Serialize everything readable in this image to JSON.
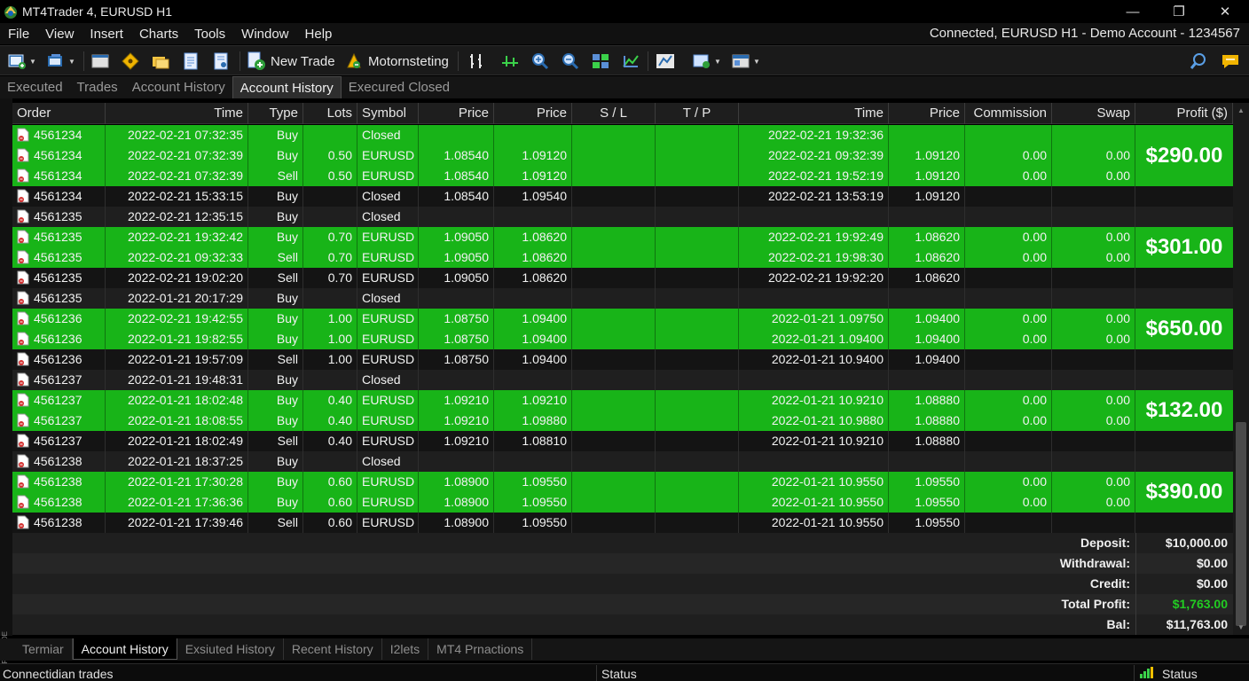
{
  "window": {
    "title": "MT4Trader 4, EURUSD  H1",
    "controls": {
      "minimize": "—",
      "restore": "❐",
      "close": "✕"
    }
  },
  "menu": {
    "items": [
      "File",
      "View",
      "Insert",
      "Charts",
      "Tools",
      "Window",
      "Help"
    ],
    "connection_status": "Connected, EURUSD H1 - Demo Account - 1234567"
  },
  "toolbar": {
    "new_trade_label": "New Trade",
    "motorsteting_label": "Motornsteting"
  },
  "top_tabs": {
    "items": [
      "Executed",
      "Trades",
      "Account History",
      "Account History",
      "Execured Closed"
    ],
    "active_index": 3
  },
  "table": {
    "headers": [
      "Order",
      "Time",
      "Type",
      "Lots",
      "Symbol",
      "Price",
      "Price",
      "S / L",
      "T / P",
      "Time",
      "Price",
      "Commission",
      "Swap",
      "Profit ($)"
    ],
    "rows": [
      {
        "style": "g",
        "order": "4561234",
        "time": "2022-02-21 07:32:35",
        "type": "Buy",
        "lots": "",
        "symbol": "Closed",
        "price1": "",
        "price2": "",
        "sl": "",
        "tp": "",
        "time2": "2022-02-21 19:32:36",
        "price3": "",
        "commission": "",
        "swap": ""
      },
      {
        "style": "g",
        "order": "4561234",
        "time": "2022-02-21 07:32:39",
        "type": "Buy",
        "lots": "0.50",
        "symbol": "EURUSD",
        "price1": "1.08540",
        "price2": "1.09120",
        "sl": "",
        "tp": "",
        "time2": "2022-02-21 09:32:39",
        "price3": "1.09120",
        "commission": "0.00",
        "swap": "0.00"
      },
      {
        "style": "g",
        "order": "4561234",
        "time": "2022-02-21 07:32:39",
        "type": "Sell",
        "lots": "0.50",
        "symbol": "EURUSD",
        "price1": "1.08540",
        "price2": "1.09120",
        "sl": "",
        "tp": "",
        "time2": "2022-02-21 19:52:19",
        "price3": "1.09120",
        "commission": "0.00",
        "swap": "0.00"
      },
      {
        "style": "d",
        "order": "4561234",
        "time": "2022-02-21 15:33:15",
        "type": "Buy",
        "lots": "",
        "symbol": "Closed",
        "price1": "1.08540",
        "price2": "1.09540",
        "sl": "",
        "tp": "",
        "time2": "2022-02-21 13:53:19",
        "price3": "1.09120",
        "commission": "",
        "swap": ""
      },
      {
        "style": "d2",
        "order": "4561235",
        "time": "2022-02-21 12:35:15",
        "type": "Buy",
        "lots": "",
        "symbol": "Closed",
        "price1": "",
        "price2": "",
        "sl": "",
        "tp": "",
        "time2": "",
        "price3": "",
        "commission": "",
        "swap": ""
      },
      {
        "style": "g",
        "order": "4561235",
        "time": "2022-02-21 19:32:42",
        "type": "Buy",
        "lots": "0.70",
        "symbol": "EURUSD",
        "price1": "1.09050",
        "price2": "1.08620",
        "sl": "",
        "tp": "",
        "time2": "2022-02-21 19:92:49",
        "price3": "1.08620",
        "commission": "0.00",
        "swap": "0.00"
      },
      {
        "style": "g",
        "order": "4561235",
        "time": "2022-02-21 09:32:33",
        "type": "Sell",
        "lots": "0.70",
        "symbol": "EURUSD",
        "price1": "1.09050",
        "price2": "1.08620",
        "sl": "",
        "tp": "",
        "time2": "2022-02-21 19:98:30",
        "price3": "1.08620",
        "commission": "0.00",
        "swap": "0.00"
      },
      {
        "style": "d",
        "order": "4561235",
        "time": "2022-02-21 19:02:20",
        "type": "Sell",
        "lots": "0.70",
        "symbol": "EURUSD",
        "price1": "1.09050",
        "price2": "1.08620",
        "sl": "",
        "tp": "",
        "time2": "2022-02-21 19:92:20",
        "price3": "1.08620",
        "commission": "",
        "swap": ""
      },
      {
        "style": "d2",
        "order": "4561235",
        "time": "2022-01-21 20:17:29",
        "type": "Buy",
        "lots": "",
        "symbol": "Closed",
        "price1": "",
        "price2": "",
        "sl": "",
        "tp": "",
        "time2": "",
        "price3": "",
        "commission": "",
        "swap": ""
      },
      {
        "style": "g",
        "order": "4561236",
        "time": "2022-02-21 19:42:55",
        "type": "Buy",
        "lots": "1.00",
        "symbol": "EURUSD",
        "price1": "1.08750",
        "price2": "1.09400",
        "sl": "",
        "tp": "",
        "time2": "2022-01-21 1.09750",
        "price3": "1.09400",
        "commission": "0.00",
        "swap": "0.00"
      },
      {
        "style": "g",
        "order": "4561236",
        "time": "2022-01-21 19:82:55",
        "type": "Buy",
        "lots": "1.00",
        "symbol": "EURUSD",
        "price1": "1.08750",
        "price2": "1.09400",
        "sl": "",
        "tp": "",
        "time2": "2022-01-21 1.09400",
        "price3": "1.09400",
        "commission": "0.00",
        "swap": "0.00"
      },
      {
        "style": "d",
        "order": "4561236",
        "time": "2022-01-21 19:57:09",
        "type": "Sell",
        "lots": "1.00",
        "symbol": "EURUSD",
        "price1": "1.08750",
        "price2": "1.09400",
        "sl": "",
        "tp": "",
        "time2": "2022-01-21 10.9400",
        "price3": "1.09400",
        "commission": "",
        "swap": ""
      },
      {
        "style": "d2",
        "order": "4561237",
        "time": "2022-01-21 19:48:31",
        "type": "Buy",
        "lots": "",
        "symbol": "Closed",
        "price1": "",
        "price2": "",
        "sl": "",
        "tp": "",
        "time2": "",
        "price3": "",
        "commission": "",
        "swap": ""
      },
      {
        "style": "g",
        "order": "4561237",
        "time": "2022-01-21 18:02:48",
        "type": "Buy",
        "lots": "0.40",
        "symbol": "EURUSD",
        "price1": "1.09210",
        "price2": "1.09210",
        "sl": "",
        "tp": "",
        "time2": "2022-01-21 10.9210",
        "price3": "1.08880",
        "commission": "0.00",
        "swap": "0.00"
      },
      {
        "style": "g",
        "order": "4561237",
        "time": "2022-01-21 18:08:55",
        "type": "Buy",
        "lots": "0.40",
        "symbol": "EURUSD",
        "price1": "1.09210",
        "price2": "1.09880",
        "sl": "",
        "tp": "",
        "time2": "2022-01-21 10.9880",
        "price3": "1.08880",
        "commission": "0.00",
        "swap": "0.00"
      },
      {
        "style": "d",
        "order": "4561237",
        "time": "2022-01-21 18:02:49",
        "type": "Sell",
        "lots": "0.40",
        "symbol": "EURUSD",
        "price1": "1.09210",
        "price2": "1.08810",
        "sl": "",
        "tp": "",
        "time2": "2022-01-21 10.9210",
        "price3": "1.08880",
        "commission": "",
        "swap": ""
      },
      {
        "style": "d2",
        "order": "4561238",
        "time": "2022-01-21 18:37:25",
        "type": "Buy",
        "lots": "",
        "symbol": "Closed",
        "price1": "",
        "price2": "",
        "sl": "",
        "tp": "",
        "time2": "",
        "price3": "",
        "commission": "",
        "swap": ""
      },
      {
        "style": "g",
        "order": "4561238",
        "time": "2022-01-21 17:30:28",
        "type": "Buy",
        "lots": "0.60",
        "symbol": "EURUSD",
        "price1": "1.08900",
        "price2": "1.09550",
        "sl": "",
        "tp": "",
        "time2": "2022-01-21 10.9550",
        "price3": "1.09550",
        "commission": "0.00",
        "swap": "0.00"
      },
      {
        "style": "g",
        "order": "4561238",
        "time": "2022-01-21 17:36:36",
        "type": "Buy",
        "lots": "0.60",
        "symbol": "EURUSD",
        "price1": "1.08900",
        "price2": "1.09550",
        "sl": "",
        "tp": "",
        "time2": "2022-01-21 10.9550",
        "price3": "1.09550",
        "commission": "0.00",
        "swap": "0.00"
      },
      {
        "style": "d",
        "order": "4561238",
        "time": "2022-01-21 17:39:46",
        "type": "Sell",
        "lots": "0.60",
        "symbol": "EURUSD",
        "price1": "1.08900",
        "price2": "1.09550",
        "sl": "",
        "tp": "",
        "time2": "2022-01-21 10.9550",
        "price3": "1.09550",
        "commission": "",
        "swap": ""
      }
    ],
    "profit_groups": [
      {
        "value": "$290.00",
        "first_row": 0,
        "span": 3
      },
      {
        "value": "$301.00",
        "first_row": 5,
        "span": 2
      },
      {
        "value": "$650.00",
        "first_row": 9,
        "span": 2
      },
      {
        "value": "$132.00",
        "first_row": 13,
        "span": 2
      },
      {
        "value": "$390.00",
        "first_row": 17,
        "span": 2
      }
    ]
  },
  "summary": [
    {
      "label": "Deposit:",
      "value": "$10,000.00",
      "highlight": false
    },
    {
      "label": "Withdrawal:",
      "value": "$0.00",
      "highlight": false
    },
    {
      "label": "Credit:",
      "value": "$0.00",
      "highlight": false
    },
    {
      "label": "Total Profit:",
      "value": "$1,763.00",
      "highlight": true
    },
    {
      "label": "Bal:",
      "value": "$11,763.00",
      "highlight": false
    }
  ],
  "bottom_tabs": {
    "items": [
      "Termiar",
      "Account History",
      "Exsiuted History",
      "Recent History",
      "I2lets",
      "MT4 Prnactions"
    ],
    "active_index": 1,
    "side_label": "FNOIDOE"
  },
  "statusbar": {
    "left": "Connectidian trades",
    "middle": "Status",
    "right": "Status"
  },
  "colors": {
    "win_row": "#18b418",
    "total_profit": "#22cc22"
  }
}
